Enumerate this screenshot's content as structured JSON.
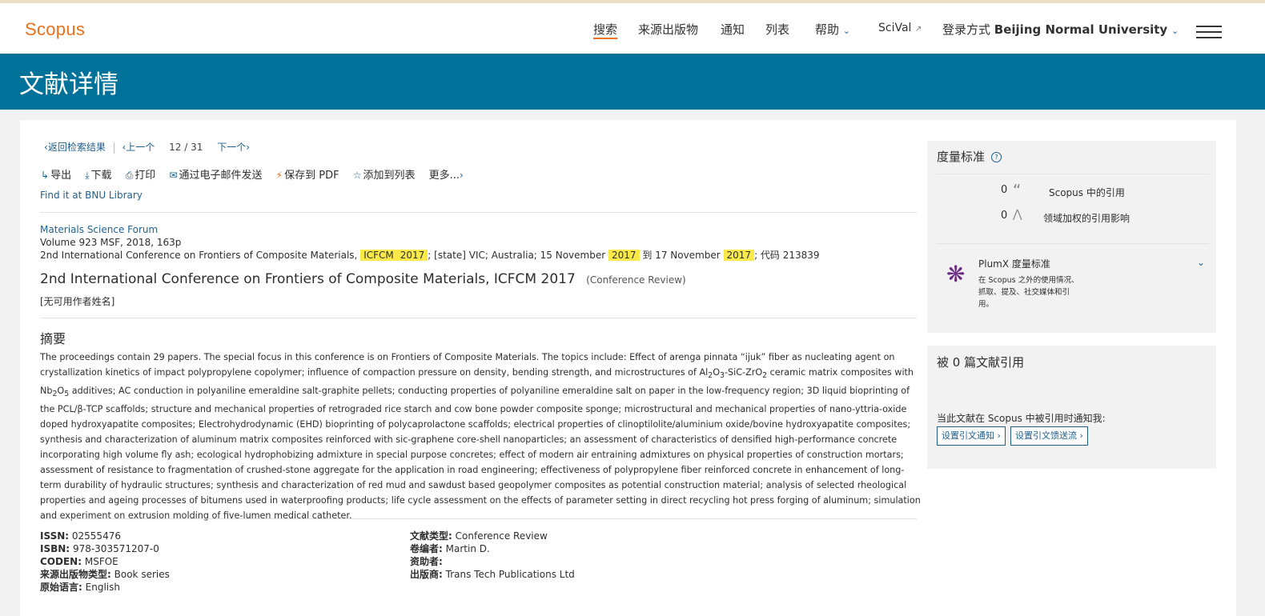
{
  "header": {
    "logo": "Scopus",
    "nav": {
      "search": "搜索",
      "sources": "来源出版物",
      "alerts": "通知",
      "lists": "列表",
      "help": "帮助",
      "scival": "SciVal",
      "login_prefix": "登录方式",
      "institution": "Beijing Normal University"
    }
  },
  "banner": {
    "title": "文献详情"
  },
  "nav_row": {
    "back": "返回检索结果",
    "prev": "上一个",
    "current": "12",
    "total": "31",
    "next": "下一个"
  },
  "actions": {
    "export": "导出",
    "download": "下载",
    "print": "打印",
    "email": "通过电子邮件发送",
    "save_pdf": "保存到 PDF",
    "add_list": "添加到列表",
    "more": "更多..."
  },
  "findit": "Find it at BNU Library",
  "source": {
    "journal": "Materials Science Forum",
    "volume_line": "Volume 923 MSF, 2018, 163p",
    "conf_prefix": "2nd International Conference on Frontiers of Composite Materials,",
    "hl_icfcm": "ICFCM",
    "hl_year1": "2017",
    "conf_mid1": "; [state] VIC; Australia; 15 November",
    "hl_year2": "2017",
    "conf_mid2": "到 17 November",
    "hl_year3": "2017",
    "conf_code": "; 代码 213839"
  },
  "document": {
    "title": "2nd International Conference on Frontiers of Composite Materials, ICFCM 2017",
    "type": "(Conference Review)",
    "authors": "[无可用作者姓名]"
  },
  "abstract": {
    "heading": "摘要",
    "p1": "The proceedings contain 29 papers. The special focus in this conference is on Frontiers of Composite Materials. The topics include: Effect of arenga pinnata “ijuk” fiber as nucleating agent on crystallization kinetics of impact polypropylene copolymer; influence of compaction pressure on density, bending strength, and microstructures of Al",
    "s1": "2",
    "p2": "O",
    "s2": "3",
    "p3": "-SiC-ZrO",
    "s3": "2",
    "p4": " ceramic matrix composites with Nb",
    "s4": "2",
    "p5": "O",
    "s5": "5",
    "p6": " additives; AC conduction in polyaniline emeraldine salt-graphite pellets; conducting properties of polyaniline emeraldine salt on paper in the low-frequency region; 3D liquid bioprinting of the PCL/β-TCP scaffolds; structure and mechanical properties of retrograded rice starch and cow bone powder composite sponge; microstructural and mechanical properties of nano-yttria-oxide doped hydroxyapatite composites; Electrohydrodynamic (EHD) bioprinting of polycaprolactone scaffolds; electrical properties of clinoptilolite/aluminium oxide/bovine hydroxyapatite composites; synthesis and characterization of aluminum matrix composites reinforced with sic-graphene core-shell nanoparticles; an assessment of characteristics of densified high-performance concrete incorporating high volume fly ash; ecological hydrophobizing admixture in special purpose concretes; effect of modern air entraining admixtures on physical properties of construction mortars; assessment of resistance to fragmentation of crushed-stone aggregate for the application in road engineering; effectiveness of polypropylene fiber reinforced concrete in enhancement of long-term durability of hydraulic structures; synthesis and characterization of red mud and sawdust based geopolymer composites as potential construction material; analysis of selected rheological properties and ageing processes of bitumens used in waterproofing products; life cycle assessment on the effects of parameter setting in direct recycling hot press forging of aluminum; simulation and experiment on extrusion molding of five-lumen medical catheter."
  },
  "meta_left": {
    "issn_label": "ISSN:",
    "issn": "02555476",
    "isbn_label": "ISBN:",
    "isbn": "978-303571207-0",
    "coden_label": "CODEN:",
    "coden": "MSFOE",
    "source_type_label": "来源出版物类型:",
    "source_type": "Book series",
    "language_label": "原始语言:",
    "language": "English"
  },
  "meta_right": {
    "doc_type_label": "文献类型:",
    "doc_type": "Conference Review",
    "editor_label": "卷编者:",
    "editor": "Martin D.",
    "sponsor_label": "资助者:",
    "publisher_label": "出版商:",
    "publisher": "Trans Tech Publications Ltd"
  },
  "metrics": {
    "heading": "度量标准",
    "citations_count": "0",
    "citations_label": "Scopus 中的引用",
    "fwci_count": "0",
    "fwci_label": "领域加权的引用影响",
    "plumx_title": "PlumX 度量标准",
    "plumx_desc": "在 Scopus 之外的使用情况、抓取、提及、社交媒体和引用。"
  },
  "cited": {
    "heading": "被 0 篇文献引用",
    "notify_text": "当此文献在 Scopus 中被引用时通知我:",
    "alert_btn": "设置引文通知",
    "feed_btn": "设置引文馈送流"
  }
}
